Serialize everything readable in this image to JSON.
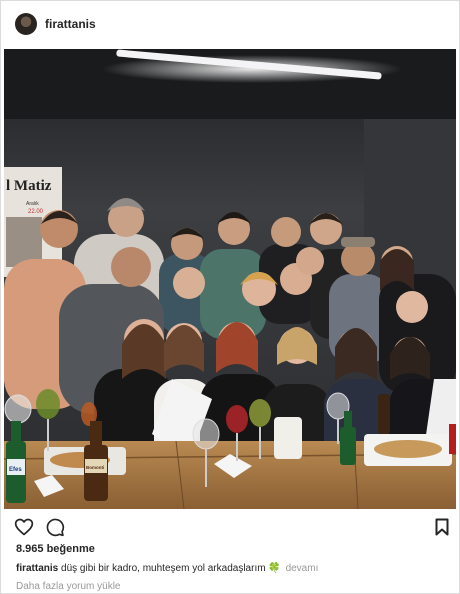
{
  "post": {
    "username": "firattanis",
    "likes": "8.965 beğenme",
    "caption_user": "firattanis",
    "caption_text": "düş gibi bir kadro, muhteşem yol arkadaşlarım",
    "caption_emoji": "🍀",
    "caption_more": "devamı",
    "load_more_comments": "Daha fazla yorum yükle"
  },
  "photo": {
    "poster_text": "l Matiz",
    "poster_date": "Aralık",
    "poster_time": "22.00",
    "bottle_labels": [
      "Efes",
      "Bomonti"
    ]
  },
  "icons": {
    "like": "heart-icon",
    "comment": "comment-icon",
    "save": "bookmark-icon",
    "avatar": "avatar-image"
  },
  "colors": {
    "text": "#262626",
    "muted": "#999999",
    "border": "#dbdbdb"
  }
}
